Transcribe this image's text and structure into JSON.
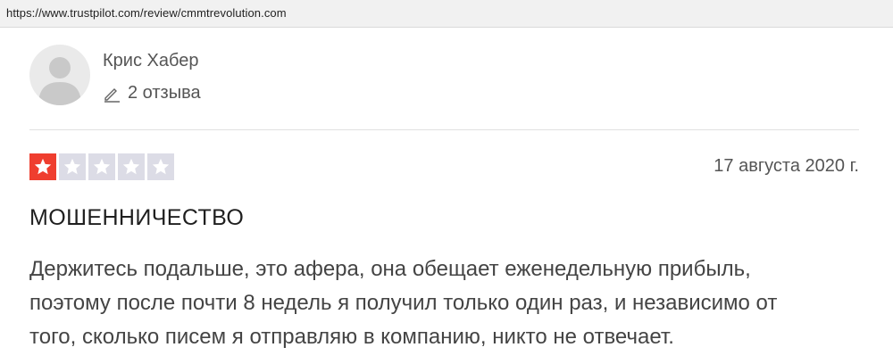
{
  "browser": {
    "url": "https://www.trustpilot.com/review/cmmtrevolution.com"
  },
  "reviewer": {
    "name": "Крис Хабер",
    "review_count": "2 отзыва",
    "avatar_icon": "user-silhouette-icon",
    "count_icon": "pencil-icon"
  },
  "review": {
    "rating": 1,
    "rating_max": 5,
    "date": "17 августа 2020 г.",
    "title": "МОШЕННИЧЕСТВО",
    "body_lines": [
      "Держитесь подальше, это афера, она обещает еженедельную прибыль,",
      "поэтому после почти 8 недель я получил только один раз, и независимо от",
      "того, сколько писем я отправляю в компанию, никто не отвечает."
    ]
  },
  "colors": {
    "star_on": "#ef3e2f",
    "star_off": "#dcdce6",
    "text_muted": "#555555"
  }
}
